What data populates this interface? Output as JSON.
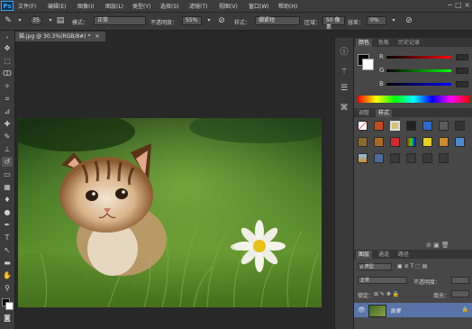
{
  "app": {
    "logo_text": "Ps"
  },
  "menu": [
    "文件(F)",
    "编辑(E)",
    "图像(I)",
    "图层(L)",
    "类型(Y)",
    "选择(S)",
    "滤镜(T)",
    "视图(V)",
    "窗口(W)",
    "帮助(H)"
  ],
  "window_controls": "− □ ×",
  "options": {
    "brush_size": "35",
    "mode_label": "模式：",
    "mode_value": "正常",
    "opacity_label": "不透明度：",
    "opacity_value": "55%",
    "style_label": "样式：",
    "style_value": "绷紧短",
    "area_label": "区域：",
    "area_value": "50 像素",
    "tolerance_label": "容差：",
    "tolerance_value": "0%"
  },
  "document": {
    "tab_label": "猫.jpg @ 30.3%(RGB/8#) *",
    "close_symbol": "×"
  },
  "color_panel": {
    "tabs": [
      "颜色",
      "色板",
      "历史记录"
    ],
    "channels": [
      "R",
      "G",
      "B"
    ],
    "foreground": "#000000",
    "background": "#ffffff"
  },
  "brush_panel": {
    "tabs": [
      "调整",
      "样式"
    ]
  },
  "layers_panel": {
    "tabs": [
      "图层",
      "通道",
      "路径"
    ],
    "kind_label": "ρ 类型",
    "blend_mode": "正常",
    "opacity_label": "不透明度：",
    "lock_label": "锁定：",
    "fill_label": "填充：",
    "layer_name": "背景"
  },
  "colors": {
    "accent": "#31a8ff",
    "selected_layer": "#5874a8"
  }
}
